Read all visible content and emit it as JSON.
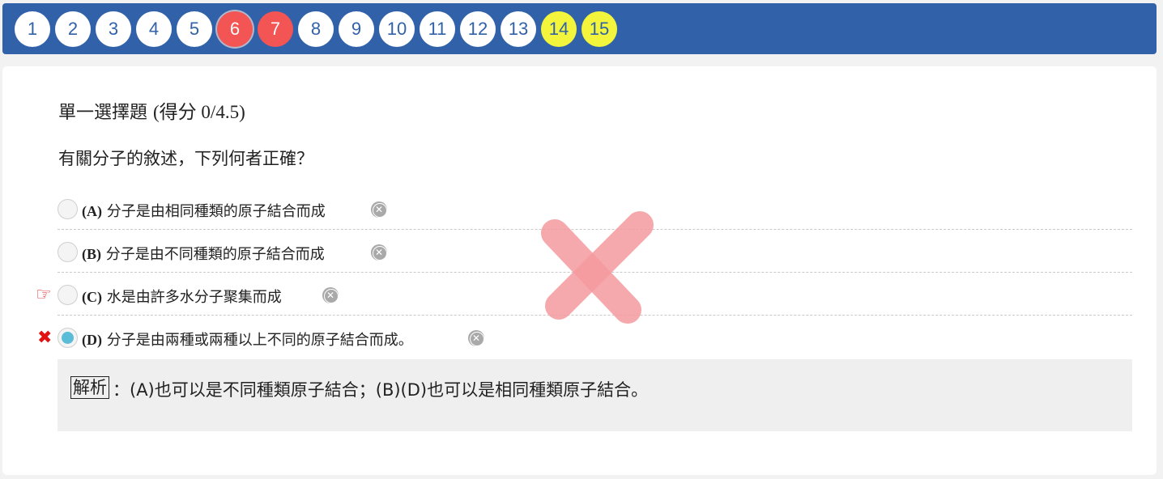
{
  "nav": {
    "questions": [
      "1",
      "2",
      "3",
      "4",
      "5",
      "6",
      "7",
      "8",
      "9",
      "10",
      "11",
      "12",
      "13",
      "14",
      "15"
    ],
    "current": "6",
    "wrong": [
      "6",
      "7"
    ],
    "marked": [
      "14",
      "15"
    ],
    "colors": {
      "bar": "#3162a9",
      "wrong": "#f35454",
      "marked": "#f2f53c"
    }
  },
  "question": {
    "type_label": "單一選擇題",
    "score_label": "(得分 0/4.5)",
    "text": "有關分子的敘述，下列何者正確？",
    "options": [
      {
        "letter": "(A)",
        "text": "分子是由相同種類的原子結合而成"
      },
      {
        "letter": "(B)",
        "text": "分子是由不同種類的原子結合而成"
      },
      {
        "letter": "(C)",
        "text": "水是由許多水分子聚集而成"
      },
      {
        "letter": "(D)",
        "text": "分子是由兩種或兩種以上不同的原子結合而成。"
      }
    ],
    "selected_option": "(D)",
    "correct_option": "(C)",
    "result": "incorrect"
  },
  "icons": {
    "correct_marker": "pointing-hand-icon",
    "wrong_marker": "x-mark-icon",
    "eliminate": "eliminate-option-icon",
    "result": "big-wrong-x-icon"
  },
  "explanation": {
    "tag": "解析",
    "text": "：(A)也可以是不同種類原子結合；(B)(D)也可以是相同種類原子結合。"
  }
}
